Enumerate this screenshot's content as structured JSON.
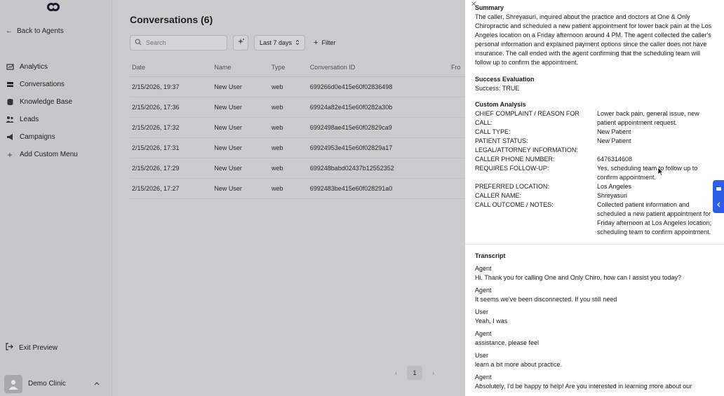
{
  "sidebar": {
    "back_label": "Back to Agents",
    "items": [
      {
        "label": "Analytics",
        "icon": "chart-icon"
      },
      {
        "label": "Conversations",
        "icon": "inbox-icon"
      },
      {
        "label": "Knowledge Base",
        "icon": "database-icon"
      },
      {
        "label": "Leads",
        "icon": "users-icon"
      },
      {
        "label": "Campaigns",
        "icon": "megaphone-icon"
      },
      {
        "label": "Add Custom Menu",
        "icon": "plus-icon"
      }
    ],
    "exit_label": "Exit Preview",
    "user_name": "Demo Clinic"
  },
  "main": {
    "title": "Conversations (6)",
    "search_placeholder": "Search",
    "range_label": "Last 7 days",
    "filter_label": "Filter",
    "columns": [
      "Date",
      "Name",
      "Type",
      "Conversation ID",
      "Fro"
    ],
    "rows": [
      [
        "2/15/2026, 19:37",
        "New User",
        "web",
        "699266d0e415e60f02836498"
      ],
      [
        "2/15/2026, 17:36",
        "New User",
        "web",
        "69924a82e415e60f0282a30b"
      ],
      [
        "2/15/2026, 17:32",
        "New User",
        "web",
        "6992498ae415e60f02829ca9"
      ],
      [
        "2/15/2026, 17:31",
        "New User",
        "web",
        "69924953e415e60f02829a17"
      ],
      [
        "2/15/2026, 17:29",
        "New User",
        "web",
        "699248babd02437b12552352"
      ],
      [
        "2/15/2026, 17:27",
        "New User",
        "web",
        "6992483be415e60f028291a0"
      ]
    ],
    "page": "1"
  },
  "panel": {
    "summary_title": "Summary",
    "summary_text": "The caller, Shreyasuri, inquired about the practice and doctors at One & Only Chiropractic and scheduled a new patient appointment for lower back pain at the Los Angeles location on a Friday afternoon around 4 PM. The agent collected the caller's personal information and explained payment options since the caller does not have insurance. The call ended with the agent confirming that the scheduling team will follow up to confirm the appointment.",
    "success_title": "Success Evaluation",
    "success_text": "Success: TRUE",
    "custom_title": "Custom Analysis",
    "custom": [
      {
        "k": "CHIEF COMPLAINT / REASON FOR CALL:",
        "v": "Lower back pain, general issue, new patient appointment request."
      },
      {
        "k": "CALL TYPE:",
        "v": "New Patient"
      },
      {
        "k": "PATIENT STATUS:",
        "v": "New Patient"
      },
      {
        "k": "LEGAL/ATTORNEY INFORMATION:",
        "v": ""
      },
      {
        "k": "CALLER PHONE NUMBER:",
        "v": "6476314608"
      },
      {
        "k": "REQUIRES FOLLOW-UP:",
        "v": "Yes, scheduling team to follow up to confirm appointment."
      },
      {
        "k": "PREFERRED LOCATION:",
        "v": "Los Angeles"
      },
      {
        "k": "CALLER NAME:",
        "v": "Shreyasuri"
      },
      {
        "k": "CALL OUTCOME / NOTES:",
        "v": "Collected patient information and scheduled a new patient appointment for Friday afternoon at Los Angeles location; scheduling team to confirm appointment."
      }
    ],
    "transcript_title": "Transcript",
    "transcript": [
      {
        "speaker": "Agent",
        "text": "Hi, Thank you for calling One and Only Chiro, how can I assist you today?"
      },
      {
        "speaker": "Agent",
        "text": "It seems we've been disconnected. If you still need"
      },
      {
        "speaker": "User",
        "text": "Yeah, I was"
      },
      {
        "speaker": "Agent",
        "text": "assistance, please feel"
      },
      {
        "speaker": "User",
        "text": "learn a bit more about practice."
      },
      {
        "speaker": "Agent",
        "text": "Absolutely, I'd be happy to help! Are you interested in learning more about our"
      }
    ]
  }
}
